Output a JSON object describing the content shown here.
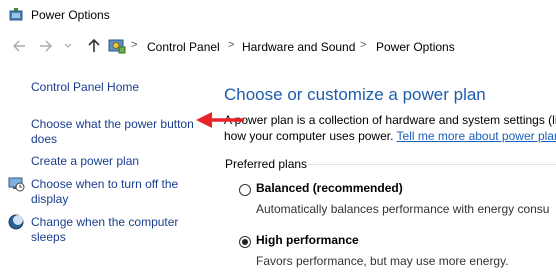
{
  "window": {
    "title": "Power Options",
    "title_icon": "power-options-icon"
  },
  "nav": {
    "back_icon": "back-arrow-icon",
    "forward_icon": "forward-arrow-icon",
    "recent_icon": "chevron-down-icon",
    "up_icon": "up-arrow-icon",
    "breadcrumbs": [
      "Control Panel",
      "Hardware and Sound",
      "Power Options"
    ],
    "separator": ">"
  },
  "sidebar": {
    "home": "Control Panel Home",
    "items": [
      {
        "line1": "Choose what the power button",
        "line2": "does",
        "icon": ""
      },
      {
        "line1": "Create a power plan",
        "line2": "",
        "icon": ""
      },
      {
        "line1": "Choose when to turn off the",
        "line2": "display",
        "icon": "display-icon"
      },
      {
        "line1": "Change when the computer",
        "line2": "sleeps",
        "icon": "moon-icon"
      }
    ]
  },
  "main": {
    "heading": "Choose or customize a power plan",
    "desc_line1": "A power plan is a collection of hardware and system settings (li",
    "desc_line2_prefix": "how your computer uses power. ",
    "desc_link": "Tell me more about power plans",
    "preferred_label": "Preferred plans",
    "plans": [
      {
        "name": "Balanced (recommended)",
        "desc": "Automatically balances performance with energy consu",
        "selected": false
      },
      {
        "name": "High performance",
        "desc": "Favors performance, but may use more energy.",
        "selected": true
      }
    ]
  },
  "annotation": {
    "arrow_color": "#e8232a",
    "icon": "red-arrow-annotation"
  },
  "colors": {
    "heading": "#1e5cad",
    "link": "#1a3e8f"
  }
}
